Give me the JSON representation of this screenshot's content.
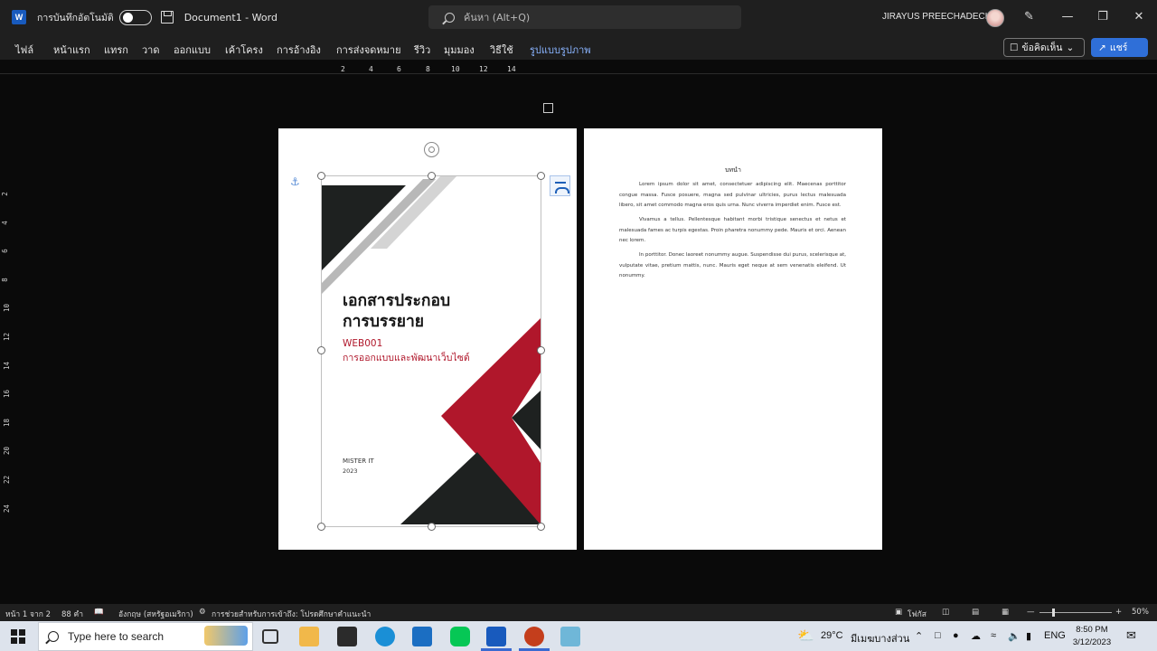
{
  "window": {
    "autosave_label": "การบันทึกอัตโนมัติ",
    "doc_title": "Document1  -  Word",
    "search_placeholder": "ค้นหา (Alt+Q)",
    "user_name": "JIRAYUS PREECHADECH"
  },
  "ribbon": {
    "tabs": [
      "ไฟล์",
      "หน้าแรก",
      "แทรก",
      "วาด",
      "ออกแบบ",
      "เค้าโครง",
      "การอ้างอิง",
      "การส่งจดหมาย",
      "รีวิว",
      "มุมมอง",
      "วิธีใช้",
      "รูปแบบรูปภาพ"
    ],
    "comment_label": "ข้อคิดเห็น",
    "share_label": "แชร์"
  },
  "ruler": {
    "h_ticks": [
      "2",
      "4",
      "6",
      "8",
      "10",
      "12",
      "14"
    ],
    "v_ticks": [
      "2",
      "4",
      "6",
      "8",
      "10",
      "12",
      "14",
      "16",
      "18",
      "20",
      "22",
      "24"
    ]
  },
  "cover": {
    "title_line1": "เอกสารประกอบ",
    "title_line2": "การบรรยาย",
    "code": "WEB001",
    "subtitle": "การออกแบบและพัฒนาเว็บไซต์",
    "author": "MISTER IT",
    "year": "2023",
    "colors": {
      "dark": "#1e2120",
      "red": "#b0172b",
      "gray": "#b8b8b8"
    }
  },
  "page2": {
    "heading": "บทนำ",
    "paragraphs": [
      "Lorem ipsum dolor sit amet, consectetuer adipiscing elit. Maecenas porttitor congue massa. Fusce posuere, magna sed pulvinar ultricies, purus lectus malesuada libero, sit amet commodo magna eros quis urna. Nunc viverra imperdiet enim. Fusce est.",
      "Vivamus a tellus. Pellentesque habitant morbi tristique senectus et netus et malesuada fames ac turpis egestas. Proin pharetra nonummy pede. Mauris et orci. Aenean nec lorem.",
      "In porttitor. Donec laoreet nonummy augue. Suspendisse dui purus, scelerisque at, vulputate vitae, pretium mattis, nunc. Mauris eget neque at sem venenatis eleifend. Ut nonummy."
    ]
  },
  "status": {
    "page": "หน้า 1 จาก 2",
    "words": "88 คำ",
    "language": "อังกฤษ (สหรัฐอเมริกา)",
    "accessibility": "การช่วยสำหรับการเข้าถึง: โปรดศึกษาคำแนะนำ",
    "focus": "โฟกัส",
    "zoom": "50%"
  },
  "taskbar": {
    "search_placeholder": "Type here to search",
    "temperature": "29°C",
    "weather": "มีเมฆบางส่วน",
    "language": "ENG",
    "time": "8:50 PM",
    "date": "3/12/2023"
  }
}
